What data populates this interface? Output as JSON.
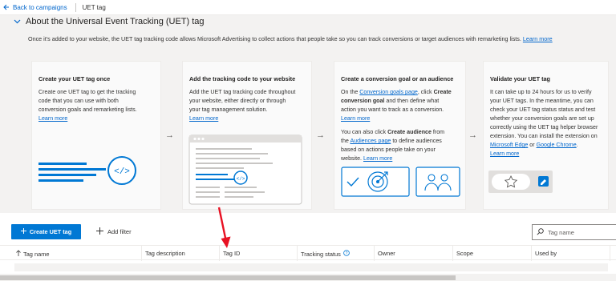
{
  "topbar": {
    "back_label": "Back to campaigns",
    "page_title": "UET tag"
  },
  "section": {
    "title": "About the Universal Event Tracking (UET) tag",
    "intro_text": "Once it's added to your website, the UET tag tracking code allows Microsoft Advertising to collect actions that people take so you can track conversions or target audiences with remarketing lists.",
    "intro_link": "Learn more"
  },
  "cards": [
    {
      "title": "Create your UET tag once",
      "lines": [
        "Create one UET tag to get the tracking",
        "code that you can use with both",
        "conversion goals and remarketing lists."
      ],
      "link": "Learn more"
    },
    {
      "title": "Add the tracking code to your website",
      "lines": [
        "Add the UET tag tracking code throughout",
        "your website, either directly or through",
        "your tag management solution."
      ],
      "link": "Learn more"
    },
    {
      "title": "Create a conversion goal or an audience",
      "p1_pre": "On the ",
      "p1_link": "Conversion goals page",
      "p1_mid": ", click ",
      "p1_bold1": "Create",
      "p1_bold2": "conversion goal",
      "p1_rest": " and then define what",
      "p1_line3": "action you want to track as a conversion.",
      "p1_learn": "Learn more",
      "p2_line1_pre": "You can also click ",
      "p2_line1_bold": "Create audience",
      "p2_line1_post": " from",
      "p2_line2_pre": "the ",
      "p2_line2_link": "Audiences page",
      "p2_line2_post": " to define audiences",
      "p2_line3": "based on actions people take on your",
      "p2_line4_pre": "website. ",
      "p2_learn": "Learn more"
    },
    {
      "title": "Validate your UET tag",
      "lines": [
        "It can take up to 24 hours for us to verify",
        "your UET tags. In the meantime, you can",
        "check your UET tag status status and test",
        "whether your conversion goals are set up",
        "correctly using the UET tag helper browser",
        "extension. You can install the extension on"
      ],
      "link_edge": "Microsoft Edge",
      "or": " or ",
      "link_chrome": "Google Chrome",
      "period": ".",
      "link": "Learn more"
    }
  ],
  "toolbar": {
    "create_label": "Create UET tag",
    "filter_label": "Add filter",
    "search_placeholder": "Tag name"
  },
  "table": {
    "columns": [
      "Tag name",
      "Tag description",
      "Tag ID",
      "Tracking status",
      "Owner",
      "Scope",
      "Used by"
    ]
  },
  "icons": {
    "back": "arrow-left-icon",
    "chevron": "chevron-down-icon",
    "plus": "plus-icon",
    "search": "search-icon",
    "info": "info-icon",
    "sort": "sort-arrow-icon"
  },
  "colors": {
    "accent": "#0078d4",
    "link": "#0066cc",
    "annotation": "#e81123"
  }
}
